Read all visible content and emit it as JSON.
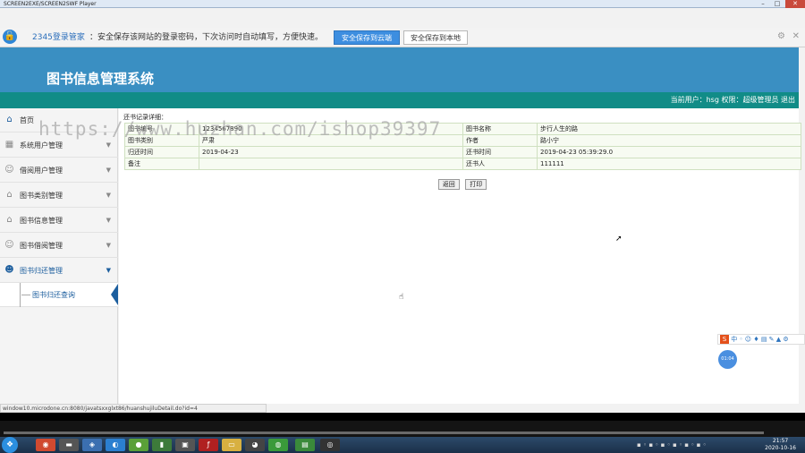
{
  "window": {
    "title": "SCREEN2EXE/SCREEN2SWF Player"
  },
  "password_bar": {
    "brand": "2345登录管家",
    "message": "：安全保存该网站的登录密码，下次访问时自动填写，方便快速。",
    "save_cloud_label": "安全保存到云端",
    "save_local_label": "安全保存到本地"
  },
  "app": {
    "title": "图书信息管理系统",
    "user_info": "当前用户：hsg 权限：超级管理员 退出"
  },
  "sidebar": {
    "items": [
      {
        "label": "首页",
        "icon": "home-icon"
      },
      {
        "label": "系统用户管理",
        "icon": "grid-icon"
      },
      {
        "label": "借阅用户管理",
        "icon": "user-icon"
      },
      {
        "label": "图书类别管理",
        "icon": "home-icon"
      },
      {
        "label": "图书信息管理",
        "icon": "home-icon"
      },
      {
        "label": "图书借阅管理",
        "icon": "user-icon"
      },
      {
        "label": "图书归还管理",
        "icon": "user-icon"
      }
    ],
    "sub_item": "图书归还查询"
  },
  "record": {
    "caption": "还书记录详细：",
    "rows": [
      [
        "图书编号",
        "1234567890",
        "图书名称",
        "步行人生的路"
      ],
      [
        "图书类别",
        "严肃",
        "作者",
        "路小宁"
      ],
      [
        "归还时间",
        "2019-04-23",
        "还书时间",
        "2019-04-23 05:39:29.0"
      ],
      [
        "备注",
        "",
        "还书人",
        "111111"
      ]
    ],
    "back_label": "返回",
    "print_label": "打印"
  },
  "status_url": "window10.microdone.cn:8080/javatsxxglxt86/huanshujiluDetail.do?id=4",
  "watermark": "https://www.huzhan.com/ishop39397",
  "ime_badge": "01:04",
  "taskbar": {
    "time": "21:57",
    "date": "2020-10-16"
  },
  "colors": {
    "banner": "#3a8fc2",
    "userbar": "#118c87",
    "accent": "#1c5e9e"
  }
}
